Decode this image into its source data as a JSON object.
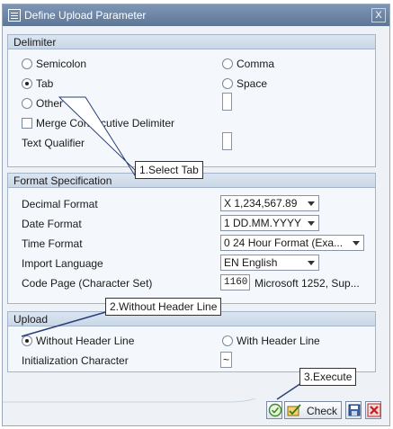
{
  "window": {
    "title": "Define Upload Parameter",
    "close_glyph": "X"
  },
  "delimiter": {
    "header": "Delimiter",
    "semicolon": "Semicolon",
    "comma": "Comma",
    "tab": "Tab",
    "space": "Space",
    "other": "Other",
    "merge": "Merge Consecutive Delimiter",
    "text_qualifier": "Text Qualifier"
  },
  "format": {
    "header": "Format Specification",
    "decimal_label": "Decimal Format",
    "decimal_value": "X 1,234,567.89",
    "date_label": "Date Format",
    "date_value": "1 DD.MM.YYYY",
    "time_label": "Time Format",
    "time_value": "0 24 Hour Format (Exa...",
    "language_label": "Import Language",
    "language_value": "EN English",
    "codepage_label": "Code Page (Character Set)",
    "codepage_value": "1160",
    "codepage_text": "Microsoft 1252, Sup..."
  },
  "upload": {
    "header": "Upload",
    "without_header": "Without Header Line",
    "with_header": "With Header Line",
    "init_label": "Initialization Character",
    "init_value": "~"
  },
  "callouts": {
    "c1": "1.Select Tab",
    "c2": "2.Without Header Line",
    "c3": "3.Execute"
  },
  "toolbar": {
    "check_label": "Check"
  },
  "icons": {
    "execute": "execute-icon",
    "check": "check-icon",
    "save": "save-icon",
    "cancel": "cancel-icon"
  }
}
